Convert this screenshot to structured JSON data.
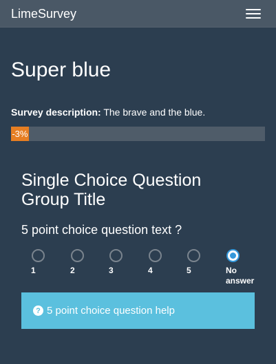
{
  "navbar": {
    "brand": "LimeSurvey"
  },
  "survey": {
    "title": "Super blue",
    "description_label": "Survey description:",
    "description": "The brave and the blue."
  },
  "progress": {
    "label": "-3%",
    "value_percent": 7
  },
  "group": {
    "title": "Single Choice Question Group Title"
  },
  "question": {
    "text": "5 point choice question text ?",
    "options": [
      "1",
      "2",
      "3",
      "4",
      "5",
      "No answer"
    ],
    "selected": "No answer",
    "help": "5 point choice question help"
  },
  "icons": {
    "menu": "hamburger-icon",
    "help": "question-circle-icon"
  },
  "colors": {
    "background": "#2c3e50",
    "navbar": "#4a5866",
    "progress": "#e67e22",
    "help": "#5bc0de",
    "radio_selected": "#3498db"
  }
}
